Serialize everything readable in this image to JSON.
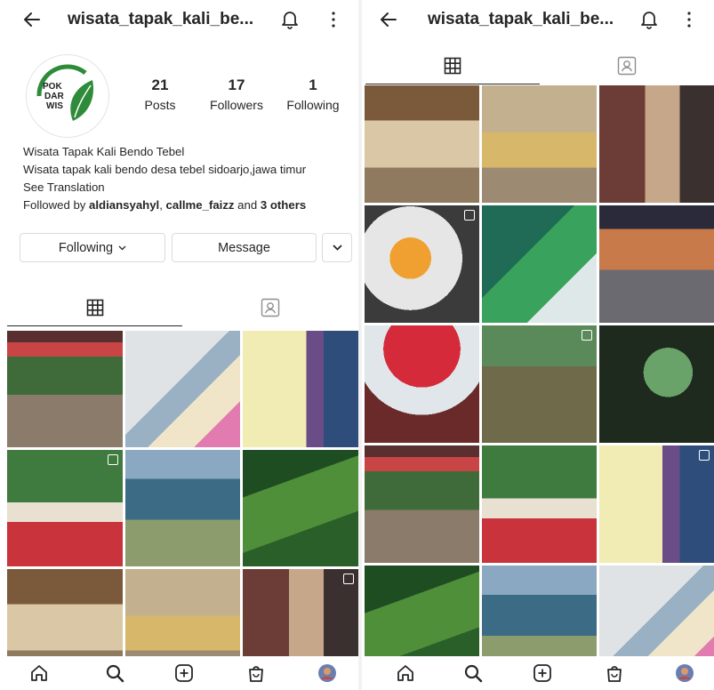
{
  "colors": {
    "text": "#262626",
    "secondary": "#8e8e8e",
    "border": "#dbdbdb",
    "logo_green": "#2e8b3a"
  },
  "left": {
    "header": {
      "title": "wisata_tapak_kali_be...",
      "back_icon": "back-arrow-icon",
      "bell_icon": "bell-icon",
      "more_icon": "more-vertical-icon"
    },
    "profile": {
      "logo_text": [
        "POK",
        "DAR",
        "WIS"
      ],
      "posts": {
        "value": "21",
        "label": "Posts"
      },
      "followers": {
        "value": "17",
        "label": "Followers"
      },
      "following": {
        "value": "1",
        "label": "Following"
      }
    },
    "bio": {
      "name": "Wisata Tapak Kali Bendo Tebel",
      "description": "Wisata tapak kali bendo desa tebel sidoarjo,jawa timur",
      "see_translation": "See Translation",
      "followed_prefix": "Followed by ",
      "followed_user1": "aldiansyahyl",
      "followed_sep": ", ",
      "followed_user2": "callme_faizz",
      "followed_and": " and ",
      "followed_others": "3 others"
    },
    "buttons": {
      "following": "Following",
      "message": "Message"
    }
  },
  "right": {
    "header": {
      "title": "wisata_tapak_kali_be...",
      "back_icon": "back-arrow-icon",
      "bell_icon": "bell-icon",
      "more_icon": "more-vertical-icon"
    }
  },
  "tabs": {
    "grid_icon": "grid-icon",
    "tagged_icon": "tagged-person-icon"
  },
  "bottom_nav": [
    "home-icon",
    "search-icon",
    "new-post-icon",
    "shop-icon",
    "profile-avatar"
  ]
}
